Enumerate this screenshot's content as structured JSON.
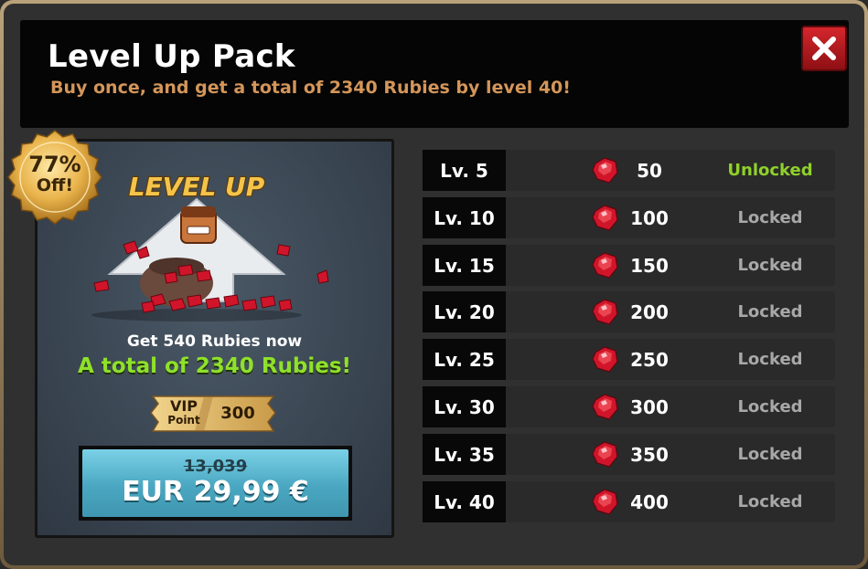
{
  "header": {
    "title": "Level Up Pack",
    "subtitle": "Buy once, and get a total of 2340 Rubies by level 40!"
  },
  "badge": {
    "percent": "77%",
    "off": "Off!"
  },
  "art": {
    "logo_text": "LEVEL UP"
  },
  "offer": {
    "get_now": "Get 540 Rubies now",
    "total": "A total of 2340 Rubies!"
  },
  "vip": {
    "label_top": "VIP",
    "label_bottom": "Point",
    "value": "300"
  },
  "price": {
    "original": "13,039",
    "current": "EUR 29,99 €"
  },
  "colors": {
    "unlocked": "#8fd12a",
    "locked": "#a8a8a8",
    "ruby": "#d0152a",
    "subtitle": "#d4965a",
    "highlight": "#8fe12a"
  },
  "rewards": [
    {
      "level": "Lv. 5",
      "amount": "50",
      "status": "Unlocked"
    },
    {
      "level": "Lv. 10",
      "amount": "100",
      "status": "Locked"
    },
    {
      "level": "Lv. 15",
      "amount": "150",
      "status": "Locked"
    },
    {
      "level": "Lv. 20",
      "amount": "200",
      "status": "Locked"
    },
    {
      "level": "Lv. 25",
      "amount": "250",
      "status": "Locked"
    },
    {
      "level": "Lv. 30",
      "amount": "300",
      "status": "Locked"
    },
    {
      "level": "Lv. 35",
      "amount": "350",
      "status": "Locked"
    },
    {
      "level": "Lv. 40",
      "amount": "400",
      "status": "Locked"
    }
  ]
}
